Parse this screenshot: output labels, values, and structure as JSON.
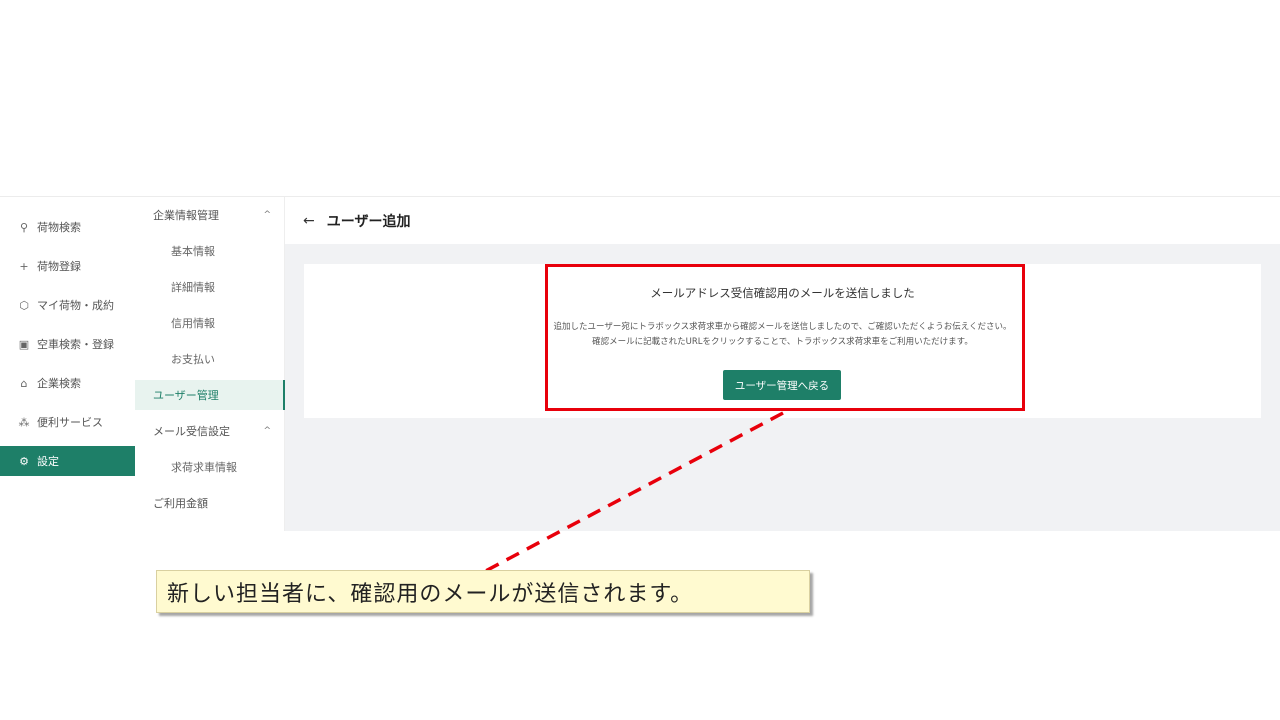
{
  "nav": {
    "items": [
      {
        "icon": "search-icon",
        "glyph": "⚲",
        "label": "荷物検索"
      },
      {
        "icon": "plus-icon",
        "glyph": "+",
        "label": "荷物登録"
      },
      {
        "icon": "cube-icon",
        "glyph": "⬡",
        "label": "マイ荷物・成約"
      },
      {
        "icon": "truck-icon",
        "glyph": "▣",
        "label": "空車検索・登録"
      },
      {
        "icon": "home-icon",
        "glyph": "⌂",
        "label": "企業検索"
      },
      {
        "icon": "service-icon",
        "glyph": "⁂",
        "label": "便利サービス"
      },
      {
        "icon": "gear-icon",
        "glyph": "⚙",
        "label": "設定"
      }
    ]
  },
  "submenu": {
    "company_info": "企業情報管理",
    "basic_info": "基本情報",
    "detail_info": "詳細情報",
    "credit_info": "信用情報",
    "payment": "お支払い",
    "user_management": "ユーザー管理",
    "mail_settings": "メール受信設定",
    "job_vehicle_info": "求荷求車情報",
    "usage_fee": "ご利用金額",
    "caret_up": "^"
  },
  "content": {
    "back_arrow": "←",
    "title": "ユーザー追加",
    "card_title": "メールアドレス受信確認用のメールを送信しました",
    "message_line1": "追加したユーザー宛にトラボックス求荷求車から確認メールを送信しましたので、ご確認いただくようお伝えください。",
    "message_line2": "確認メールに記載されたURLをクリックすることで、トラボックス求荷求車をご利用いただけます。",
    "button": "ユーザー管理へ戻る"
  },
  "annotation": {
    "callout": "新しい担当者に、確認用のメールが送信されます。",
    "highlight_color": "#e8000b"
  },
  "colors": {
    "brand": "#1e7f68",
    "callout_bg": "#fffad0"
  }
}
